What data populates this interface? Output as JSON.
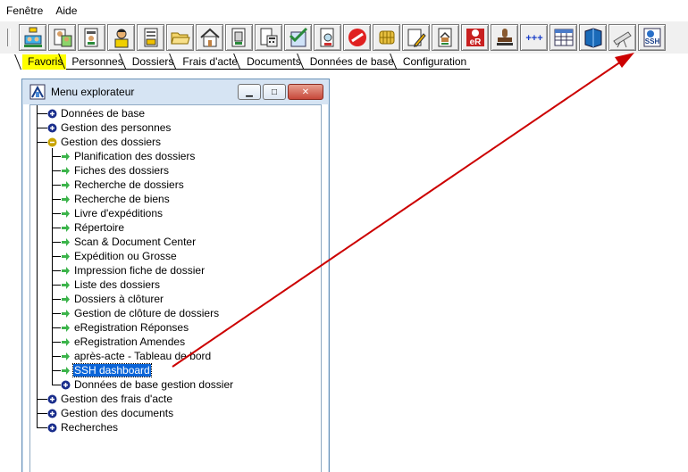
{
  "menubar": {
    "items": [
      "Fenêtre",
      "Aide"
    ]
  },
  "toolbar": {
    "icons": [
      "network-people-icon",
      "people-docs-icon",
      "person-doc-icon",
      "person-icon",
      "folder-doc-icon",
      "folder-open-icon",
      "house-icon",
      "building-doc-icon",
      "calculator-doc-icon",
      "checklist-icon",
      "search-doc-icon",
      "no-entry-icon",
      "chip-card-icon",
      "pencil-doc-icon",
      "house-doc-icon",
      "eregistration-icon",
      "stamp-icon",
      "plus-plus-icon",
      "table-icon",
      "book-icon",
      "telescope-icon",
      "ssh-dashboard-icon"
    ],
    "er_label": "eR",
    "plus_label": "+++",
    "ssh_label": "SSH"
  },
  "tabs": [
    {
      "label": "Favoris",
      "active": true
    },
    {
      "label": "Personnes"
    },
    {
      "label": "Dossiers"
    },
    {
      "label": "Frais d'acte"
    },
    {
      "label": "Documents"
    },
    {
      "label": "Données de base"
    },
    {
      "label": "Configuration"
    }
  ],
  "explorer": {
    "title": "Menu explorateur",
    "tree": {
      "donnees_base": "Données de base",
      "gestion_personnes": "Gestion des personnes",
      "gestion_dossiers": "Gestion des dossiers",
      "children": [
        "Planification des dossiers",
        "Fiches des dossiers",
        "Recherche de dossiers",
        "Recherche de biens",
        "Livre d'expéditions",
        "Répertoire",
        "Scan & Document Center",
        "Expédition ou Grosse",
        "Impression fiche de dossier",
        "Liste des dossiers",
        "Dossiers à clôturer",
        "Gestion de clôture de dossiers",
        "eRegistration Réponses",
        "eRegistration Amendes",
        "après-acte - Tableau de bord",
        "SSH dashboard"
      ],
      "donnees_base_gestion": "Données de base gestion dossier",
      "gestion_frais": "Gestion des frais d'acte",
      "gestion_documents": "Gestion des documents",
      "recherches": "Recherches"
    }
  },
  "colors": {
    "active_tab": "#ffff00",
    "selection": "#0a64d8",
    "arrow": "#cc0000",
    "expand_icon": "#1a2e8c",
    "collapse_icon": "#c8a400",
    "leaf_arrow": "#3cb44b"
  }
}
